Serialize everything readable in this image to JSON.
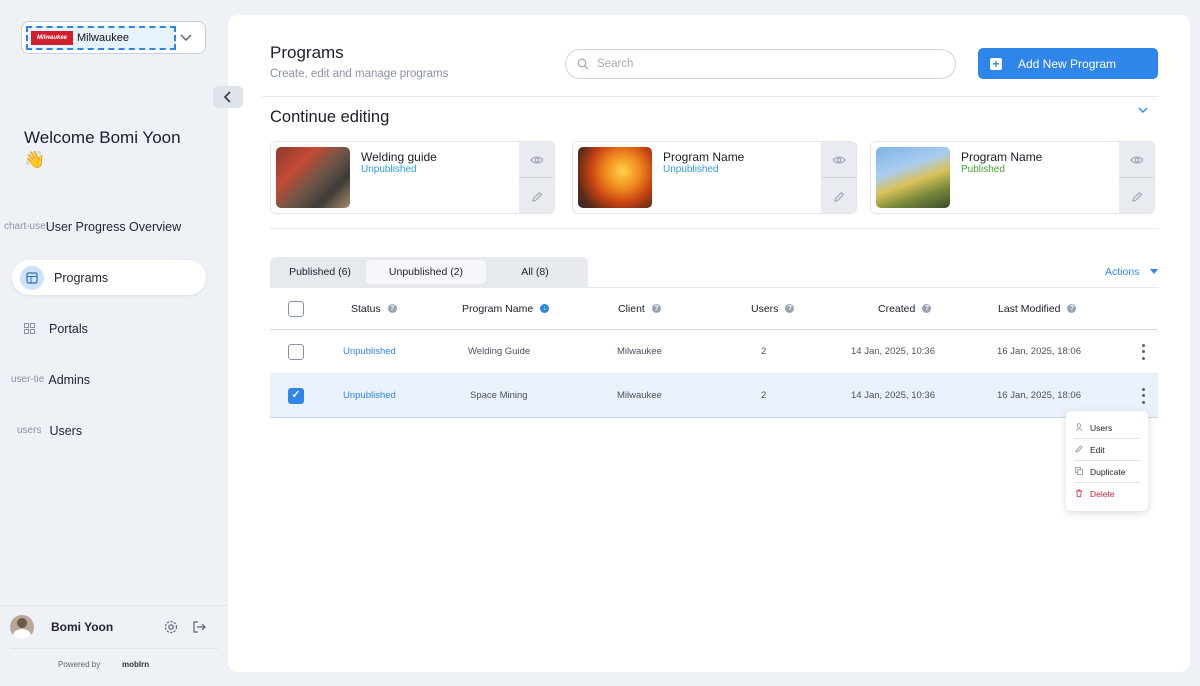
{
  "client_selector": {
    "logo_text": "Milwaukee",
    "value": "Milwaukee"
  },
  "sidebar": {
    "welcome": "Welcome Bomi Yoon 👋",
    "items": [
      {
        "icon_name": "chart-use",
        "icon_text": "chart-use",
        "label": "User Progress Overview"
      },
      {
        "icon_name": "programs",
        "icon_text": "",
        "label": "Programs"
      },
      {
        "icon_name": "portals",
        "icon_text": "",
        "label": "Portals"
      },
      {
        "icon_name": "user-tie",
        "icon_text": "user-tie",
        "label": "Admins"
      },
      {
        "icon_name": "users",
        "icon_text": "users",
        "label": "Users"
      }
    ],
    "user": {
      "name": "Bomi Yoon"
    },
    "powered_by": "Powered by",
    "brand": "mobIrn"
  },
  "header": {
    "title": "Programs",
    "subtitle": "Create, edit and manage programs",
    "search_placeholder": "Search",
    "add_button": "Add New Program"
  },
  "continue_editing": {
    "title": "Continue editing",
    "cards": [
      {
        "name": "Welding guide",
        "status": "Unpublished",
        "status_color": "#2f9be0"
      },
      {
        "name": "Program Name",
        "status": "Unpublished",
        "status_color": "#2f9be0"
      },
      {
        "name": "Program Name",
        "status": "Published",
        "status_color": "#4ca338"
      }
    ]
  },
  "tabs": [
    {
      "label": "Published (6)"
    },
    {
      "label": "Unpublished (2)"
    },
    {
      "label": "All (8)"
    }
  ],
  "actions_label": "Actions",
  "table": {
    "columns": [
      "Status",
      "Program Name",
      "Client",
      "Users",
      "Created",
      "Last Modified"
    ],
    "rows": [
      {
        "status": "Unpublished",
        "program": "Welding Guide",
        "client": "Milwaukee",
        "users": "2",
        "created": "14 Jan, 2025, 10:36",
        "modified": "16 Jan, 2025, 18:06",
        "selected": false
      },
      {
        "status": "Unpublished",
        "program": "Space Mining",
        "client": "Milwaukee",
        "users": "2",
        "created": "14 Jan, 2025, 10:36",
        "modified": "16 Jan, 2025, 18:06",
        "selected": true
      }
    ]
  },
  "row_menu": {
    "items": [
      {
        "icon": "user-icon",
        "label": "Users"
      },
      {
        "icon": "pencil-icon",
        "label": "Edit"
      },
      {
        "icon": "copy-icon",
        "label": "Duplicate"
      },
      {
        "icon": "trash-icon",
        "label": "Delete"
      }
    ]
  }
}
